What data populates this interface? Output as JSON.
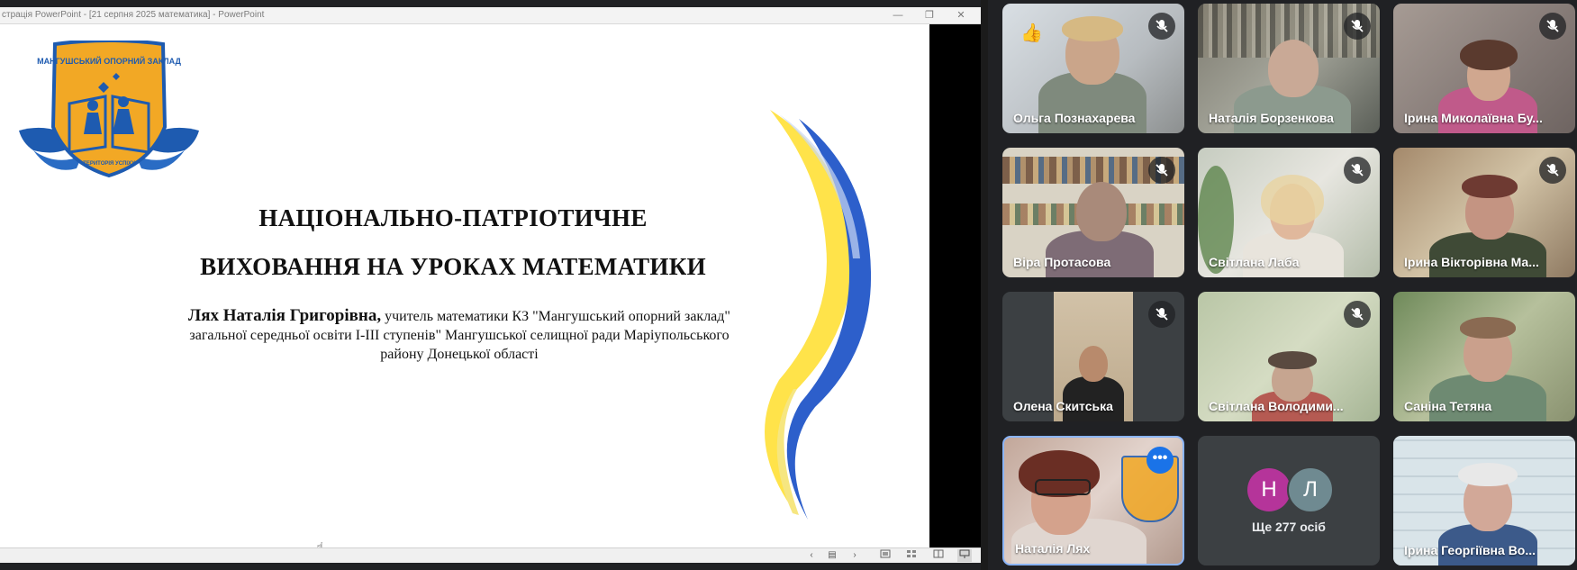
{
  "ppt": {
    "window_title": "страція PowerPoint - [21 серпня 2025 математика] - PowerPoint",
    "window_controls": {
      "minimize": "—",
      "restore": "❐",
      "close": "✕"
    }
  },
  "slide": {
    "logo": {
      "top_text": "МАНГУШСЬКИЙ ОПОРНИЙ ЗАКЛАД",
      "bottom_text": "ТЕРИТОРІЯ УСПІХУ"
    },
    "title_line1": "НАЦІОНАЛЬНО-ПАТРІОТИЧНЕ",
    "title_line2": "ВИХОВАННЯ НА УРОКАХ МАТЕМАТИКИ",
    "author_name": "Лях Наталія Григорівна,",
    "author_desc": " учитель математики КЗ \"Мангушський опорний заклад\" загальної середньої освіти І-ІІІ ступенів\" Мангушської селищної ради Маріупольського району Донецької області"
  },
  "status_bar": {
    "prev": "‹",
    "menu": "▤",
    "next": "›"
  },
  "meet": {
    "participants": [
      {
        "name": "Ольга Познахарева",
        "muted": true,
        "reaction": "👍"
      },
      {
        "name": "Наталія Борзенкова",
        "muted": true
      },
      {
        "name": "Ірина Миколаївна Бу...",
        "muted": true
      },
      {
        "name": "Віра Протасова",
        "muted": true
      },
      {
        "name": "Світлана Лаба",
        "muted": true
      },
      {
        "name": "Ірина Вікторівна Ма...",
        "muted": true
      },
      {
        "name": "Олена Скитська",
        "muted": true
      },
      {
        "name": "Світлана Володими...",
        "muted": true
      },
      {
        "name": "Саніна Тетяна",
        "muted": true
      },
      {
        "name": "Наталія Лях",
        "muted": false,
        "speaking": true
      },
      {
        "name": "Ірина Георгіївна Во...",
        "muted": false
      }
    ],
    "more": {
      "avatar1": "Н",
      "avatar2": "Л",
      "label": "Ще 277 осіб"
    },
    "colors": {
      "speaking_border": "#8ab4f8",
      "avatar1": "#b5349a",
      "avatar2": "#6f8a91"
    }
  }
}
